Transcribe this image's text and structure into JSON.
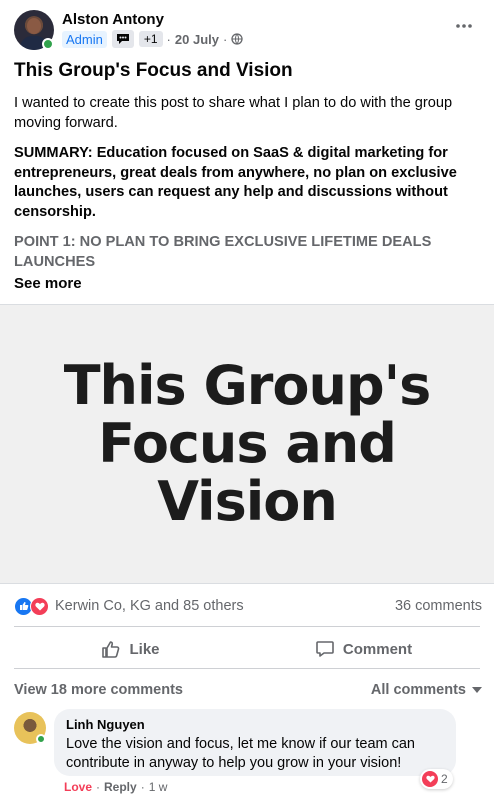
{
  "post": {
    "author": "Alston Antony",
    "badge_admin": "Admin",
    "badge_plus": "+1",
    "date": "20 July",
    "separator": "·",
    "title": "This Group's Focus and Vision",
    "paragraphs": [
      "I wanted to create this post to share what I plan to do with the group moving forward.",
      "SUMMARY: Education focused on SaaS & digital marketing for entrepreneurs, great deals from anywhere, no plan on exclusive launches, users can request any help and discussions without censorship.",
      "POINT 1: NO PLAN TO BRING EXCLUSIVE LIFETIME DEALS LAUNCHES"
    ],
    "see_more": "See more",
    "image_text_lines": [
      "This Group's",
      "Focus and",
      "Vision"
    ]
  },
  "reactions": {
    "summary": "Kerwin Co, KG and 85 others",
    "comments_count": "36 comments"
  },
  "actions": {
    "like": "Like",
    "comment": "Comment"
  },
  "comments_section": {
    "view_more": "View 18 more comments",
    "filter": "All comments"
  },
  "comment": {
    "author": "Linh Nguyen",
    "text": "Love the vision and focus, let me know if our team can contribute in anyway to help you grow in your vision!",
    "reaction_count": "2",
    "action_love": "Love",
    "action_reply": "Reply",
    "time": "1 w",
    "separator": "·"
  },
  "colors": {
    "accent_blue": "#1877f2",
    "love_red": "#f33e58",
    "online_green": "#31a24c",
    "muted_text": "#65676b"
  },
  "icons": {
    "more": "more-horizontal-icon",
    "badge": "conversation-starter-icon",
    "audience": "globe-icon",
    "like_reaction": "like-reaction-icon",
    "love_reaction": "love-reaction-icon",
    "like_action": "thumbs-up-icon",
    "comment_action": "comment-bubble-icon",
    "filter_caret": "caret-down-icon"
  }
}
